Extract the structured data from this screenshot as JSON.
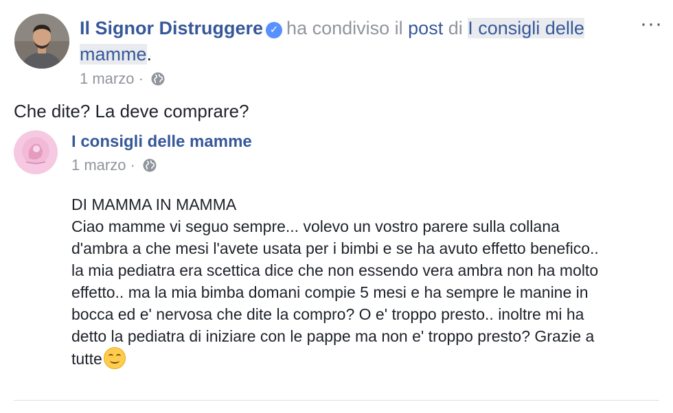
{
  "header": {
    "author": "Il Signor Distruggere",
    "verb": "ha condiviso il",
    "post_link": "post",
    "of": "di",
    "page_link": "I consigli delle mamme",
    "period": ".",
    "date": "1 marzo",
    "separator": "·",
    "more": "···"
  },
  "status_text": "Che dite? La deve comprare?",
  "shared": {
    "page_name": "I consigli delle mamme",
    "date": "1 marzo",
    "separator": "·",
    "lines": [
      "DI MAMMA IN MAMMA",
      "Ciao mamme vi seguo sempre... volevo un vostro parere sulla collana",
      "d'ambra a che mesi l'avete usata per i bimbi e se ha avuto effetto benefico..",
      "la mia pediatra era scettica dice che non essendo vera ambra non ha molto",
      "effetto.. ma la mia bimba domani compie 5 mesi e ha sempre le manine in",
      "bocca ed e' nervosa che dite la compro? O e' troppo presto.. inoltre mi ha",
      "detto la pediatra di iniziare con le pappe ma non e' troppo presto? Grazie a",
      "tutte"
    ]
  },
  "icons": {
    "verified": "verified-badge-icon",
    "globe": "globe-icon",
    "emoji": "smiling-face-icon"
  },
  "colors": {
    "link": "#365899",
    "meta": "#90949c",
    "text": "#1d2129",
    "verified": "#5890ff"
  }
}
